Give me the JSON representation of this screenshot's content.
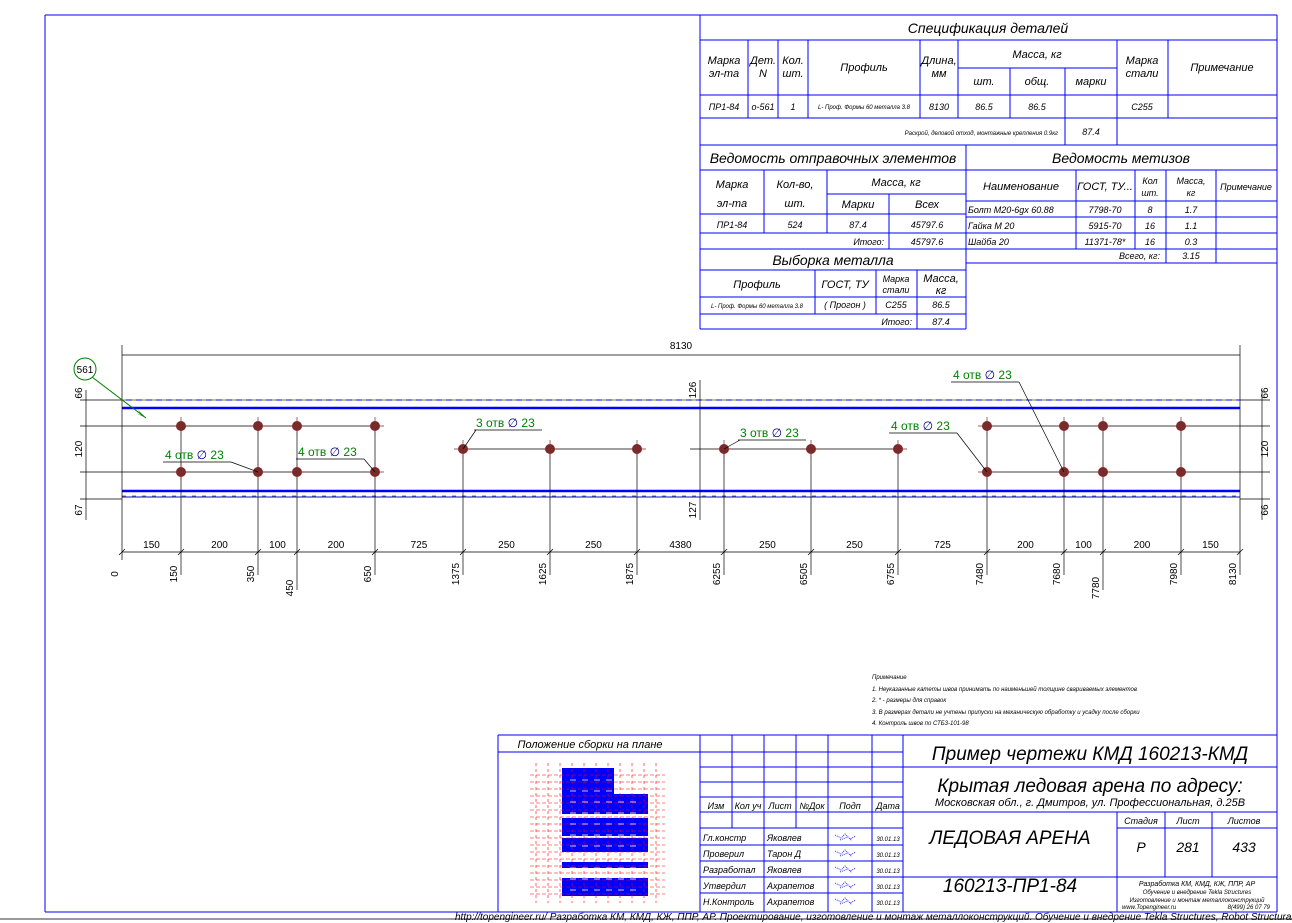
{
  "colors": {
    "frame": "#0000ff",
    "bolt": "#7a2a2a",
    "callout": "#008000",
    "plan_fill": "#0000ff",
    "plan_grid": "#ff0000"
  },
  "spec": {
    "title": "Спецификация деталей",
    "headers": {
      "mark": [
        "Марка",
        "эл-та"
      ],
      "det": [
        "Дет.",
        "N"
      ],
      "qty": [
        "Кол.",
        "шт."
      ],
      "profile": "Профиль",
      "length": [
        "Длина,",
        "мм"
      ],
      "mass": "Масса, кг",
      "mass_each": "шт.",
      "mass_total": "общ.",
      "mass_mark": "марки",
      "steel": [
        "Марка",
        "стали"
      ],
      "note": "Примечание"
    },
    "row": {
      "mark": "ПР1-84",
      "det": "о-561",
      "qty": "1",
      "profile": "L- Проф. Формы 60 металла 3.8",
      "length": "8130",
      "mass_each": "86.5",
      "mass_total": "86.5",
      "mass_mark": "",
      "steel": "С255",
      "note": ""
    },
    "footer_label": "Раскрой, деловой отход, монтажные крепления 0.9кг",
    "footer_value": "87.4"
  },
  "shipping": {
    "title": "Ведомость отправочных элементов",
    "headers": {
      "mark": [
        "Марка",
        "эл-та"
      ],
      "qty": [
        "Кол-во,",
        "шт."
      ],
      "mass": "Масса, кг",
      "mass_mark": "Марки",
      "mass_all": "Всех"
    },
    "row": {
      "mark": "ПР1-84",
      "qty": "524",
      "mass_mark": "87.4",
      "mass_all": "45797.6"
    },
    "total_label": "Итого:",
    "total_value": "45797.6"
  },
  "metal": {
    "title": "Выборка металла",
    "headers": {
      "profile": "Профиль",
      "gost": "ГОСТ, ТУ",
      "steel": [
        "Марка",
        "стали"
      ],
      "mass": [
        "Масса,",
        "кг"
      ]
    },
    "row": {
      "profile": "L- Проф. Формы 60 металла 3.8",
      "gost": "( Прогон )",
      "steel": "С255",
      "mass": "86.5"
    },
    "total_label": "Итого:",
    "total_value": "87.4"
  },
  "hardware": {
    "title": "Ведомость метизов",
    "headers": {
      "name": "Наименование",
      "gost": "ГОСТ, ТУ...",
      "qty": [
        "Кол",
        "шт."
      ],
      "mass": [
        "Масса,",
        "кг"
      ],
      "note": "Примечание"
    },
    "rows": [
      {
        "name": "Болт М20-6gх 60.88",
        "gost": "7798-70",
        "qty": "8",
        "mass": "1.7"
      },
      {
        "name": "Гайка М 20",
        "gost": "5915-70",
        "qty": "16",
        "mass": "1.1"
      },
      {
        "name": "Шайба 20",
        "gost": "11371-78*",
        "qty": "16",
        "mass": "0.3"
      }
    ],
    "total_label": "Всего, кг:",
    "total_value": "3.15"
  },
  "drawing": {
    "overall_length": "8130",
    "position_mark": "561",
    "left_dims": [
      "66",
      "120",
      "67"
    ],
    "right_dims": [
      "66",
      "120",
      "66"
    ],
    "mid_dims": [
      "126",
      "127"
    ],
    "chain_dims": [
      "150",
      "200",
      "100",
      "200",
      "725",
      "250",
      "250",
      "4380",
      "250",
      "250",
      "725",
      "200",
      "100",
      "200",
      "150"
    ],
    "ordinates": [
      "0",
      "150",
      "350",
      "450",
      "650",
      "1375",
      "1625",
      "1875",
      "6255",
      "6505",
      "6755",
      "7480",
      "7680",
      "7780",
      "7980",
      "8130"
    ],
    "callouts": [
      "4 отв",
      "4 отв",
      "3 отв",
      "3 отв",
      "4 отв",
      "4 отв"
    ],
    "hole_diameter": "23"
  },
  "notes": {
    "title": "Примечание",
    "items": [
      "1. Неуказанные катеты швов принимать по наименьшей толщине свариваемых элементов",
      "2. * - размеры для справок",
      "3. В размерах детали не учтены припуски на механическую обработку и усадку после сборки",
      "4. Контроль швов по СТБ3-101-98"
    ]
  },
  "titleblock": {
    "plan_title": "Положение сборки на плане",
    "change_headers": [
      "Изм",
      "Кол уч",
      "Лист",
      "№Док",
      "Подп",
      "Дата"
    ],
    "signers": [
      {
        "role": "Гл.констр",
        "name": "Яковлев",
        "date": "30.01.13"
      },
      {
        "role": "Проверил",
        "name": "Тарон Д",
        "date": "30.01.13"
      },
      {
        "role": "Разработал",
        "name": "Яковлев",
        "date": "30.01.13"
      },
      {
        "role": "Утвердил",
        "name": "Ахрапетов",
        "date": "30.01.13"
      },
      {
        "role": "Н.Контроль",
        "name": "Ахрапетов",
        "date": "30.01.13"
      }
    ],
    "project": "Пример чертежи КМД  160213-КМД",
    "object": "Крытая ледовая арена по адресу:",
    "address": "Московская обл., г. Дмитров, ул. Профессиональная, д.25В",
    "sheet_name": "ЛЕДОВАЯ АРЕНА",
    "stage_label": "Стадия",
    "sheet_label": "Лист",
    "sheets_label": "Листов",
    "stage": "Р",
    "sheet": "281",
    "sheets": "433",
    "drawing_code": "160213-ПР1-84",
    "company": [
      "Разработка КМ, КМД, КЖ, ППР, АР",
      "Обучение и внедрение Tekla Structures",
      "Изготовление и монтаж металлоконструкций"
    ],
    "website": "www.Topengineer.ru",
    "phone": "8(499) 26 07 79"
  },
  "footer": "http://topengineer.ru/  Разработка КМ, КМД, КЖ, ППР, АР. Проектирование, изготовление и монтаж металлоконструкций. Обучение и внедрение Tekla Structures, Robot Structural Analysis."
}
